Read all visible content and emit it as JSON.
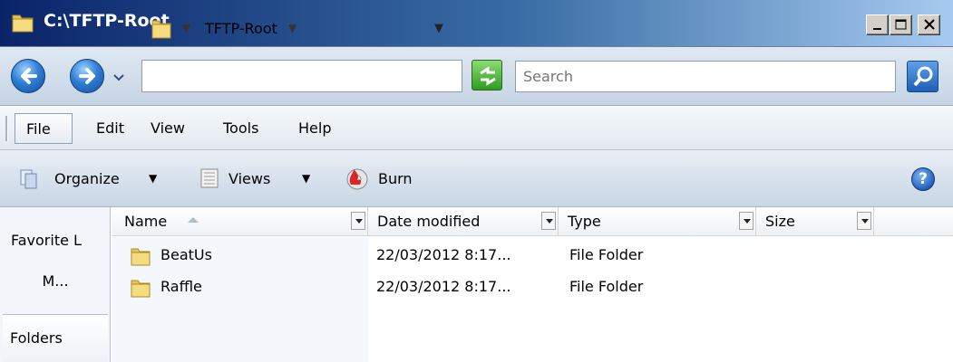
{
  "window": {
    "title": "C:\\TFTP-Root",
    "controls": {
      "minimize_icon": "minimize-icon",
      "maximize_icon": "maximize-icon",
      "close_icon": "close-icon"
    }
  },
  "address_bar": {
    "back_icon": "back-arrow-icon",
    "forward_icon": "forward-arrow-icon",
    "path_segment": "TFTP-Root",
    "refresh_icon": "refresh-icon",
    "search_placeholder": "Search",
    "search_icon": "search-icon"
  },
  "menu": [
    "File",
    "Edit",
    "View",
    "Tools",
    "Help"
  ],
  "toolbar": {
    "organize": "Organize",
    "views": "Views",
    "burn": "Burn",
    "help_icon": "help-icon"
  },
  "nav_pane": {
    "favorites": "Favorite L",
    "more": "M...",
    "folders": "Folders"
  },
  "columns": [
    "Name",
    "Date modified",
    "Type",
    "Size"
  ],
  "files": [
    {
      "name": "BeatUs",
      "date": "22/03/2012 8:17...",
      "type": "File Folder"
    },
    {
      "name": "Raffle",
      "date": "22/03/2012 8:17...",
      "type": "File Folder"
    }
  ],
  "colors": {
    "titlebar": "#0a246a",
    "accent": "#2f7fd6"
  }
}
